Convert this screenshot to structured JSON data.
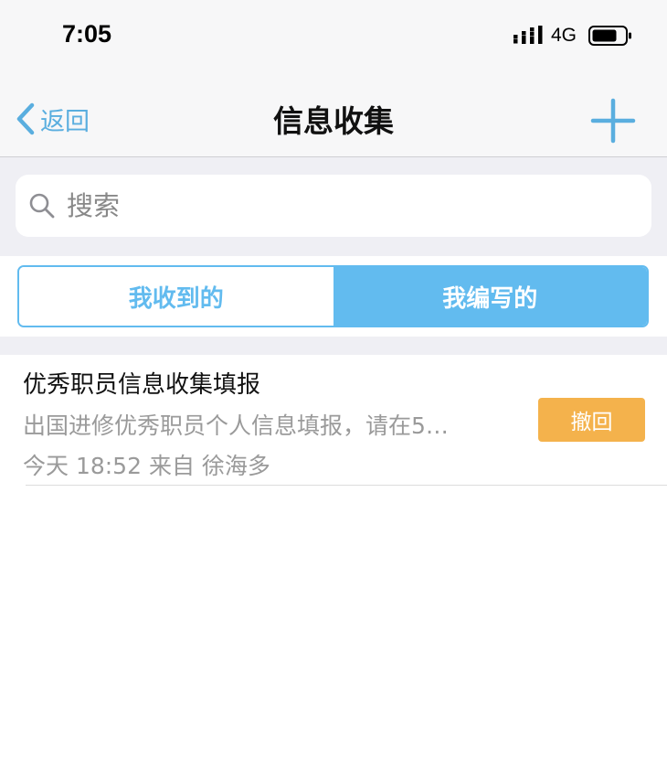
{
  "status_bar": {
    "time": "7:05",
    "network": "4G",
    "icons": [
      "signal-icon",
      "battery-icon"
    ]
  },
  "nav": {
    "back_label": "返回",
    "title": "信息收集",
    "add_icon": "plus-icon"
  },
  "search": {
    "placeholder": "搜索",
    "value": ""
  },
  "tabs": [
    {
      "label": "我收到的",
      "active": false
    },
    {
      "label": "我编写的",
      "active": true
    }
  ],
  "list": [
    {
      "title": "优秀职员信息收集填报",
      "description": "出国进修优秀职员个人信息填报，请在5…",
      "meta": "今天 18:52 来自 徐海多",
      "action_label": "撤回"
    }
  ],
  "colors": {
    "accent": "#62bbef",
    "link": "#5aaedf",
    "recall": "#f4b24c",
    "bar_bg": "#f7f7f8",
    "group_bg": "#efeff4"
  }
}
